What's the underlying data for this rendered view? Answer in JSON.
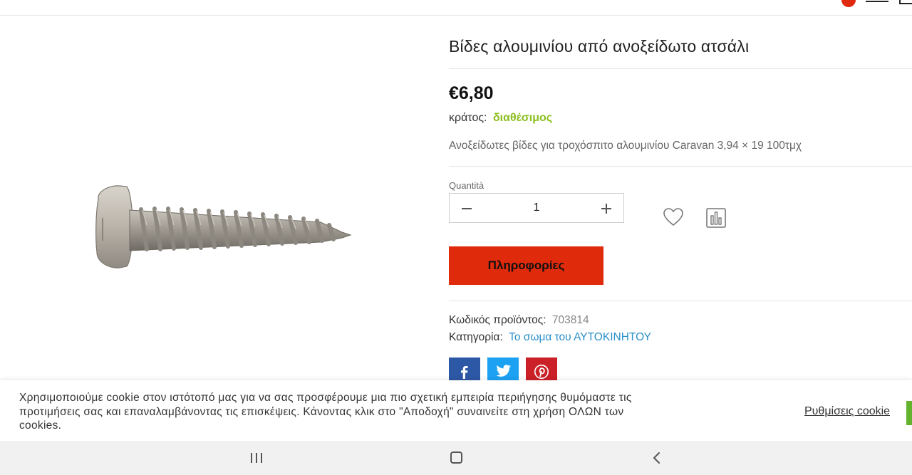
{
  "header": {
    "cart_icon": "cart-icon",
    "menu_icon": "hamburger-menu-icon"
  },
  "product": {
    "image_alt": "stainless-steel-screw-image",
    "title": "Βίδες αλουμινίου από ανοξείδωτο ατσάλι",
    "price": "€6,80",
    "stock_label": "κράτος:",
    "stock_value": "διαθέσιμος",
    "description": "Ανοξείδωτες βίδες για τροχόσπιτο αλουμινίου Caravan 3,94 × 19 100τμχ",
    "quantity_label": "Quantità",
    "quantity_value": "1",
    "info_button_label": "Πληροφορίες",
    "sku_label": "Κωδικός προϊόντος:",
    "sku_value": "703814",
    "category_label": "Κατηγορία:",
    "category_value": "Το σωμα του ΑΥΤΟΚΙΝΗΤΟΥ"
  },
  "share": {
    "facebook_icon": "facebook-icon",
    "twitter_icon": "twitter-icon",
    "pinterest_icon": "pinterest-icon"
  },
  "cookie": {
    "text": "Χρησιμοποιούμε cookie στον ιστότοπό μας για να σας προσφέρουμε μια πιο σχετική εμπειρία περιήγησης θυμόμαστε τις προτιμήσεις σας και επαναλαμβάνοντας τις επισκέψεις. Κάνοντας κλικ στο \"Αποδοχή\" συναινείτε στη χρήση ΟΛΩΝ των cookies.",
    "settings_label": "Ρυθμίσεις cookie"
  },
  "colors": {
    "accent_red": "#e02a0c",
    "stock_green": "#8bbf1e",
    "link_blue": "#2a8fc8",
    "facebook": "#2d58a5",
    "twitter": "#1da1f2",
    "pinterest": "#cb2027",
    "accept_green": "#63b32e"
  }
}
